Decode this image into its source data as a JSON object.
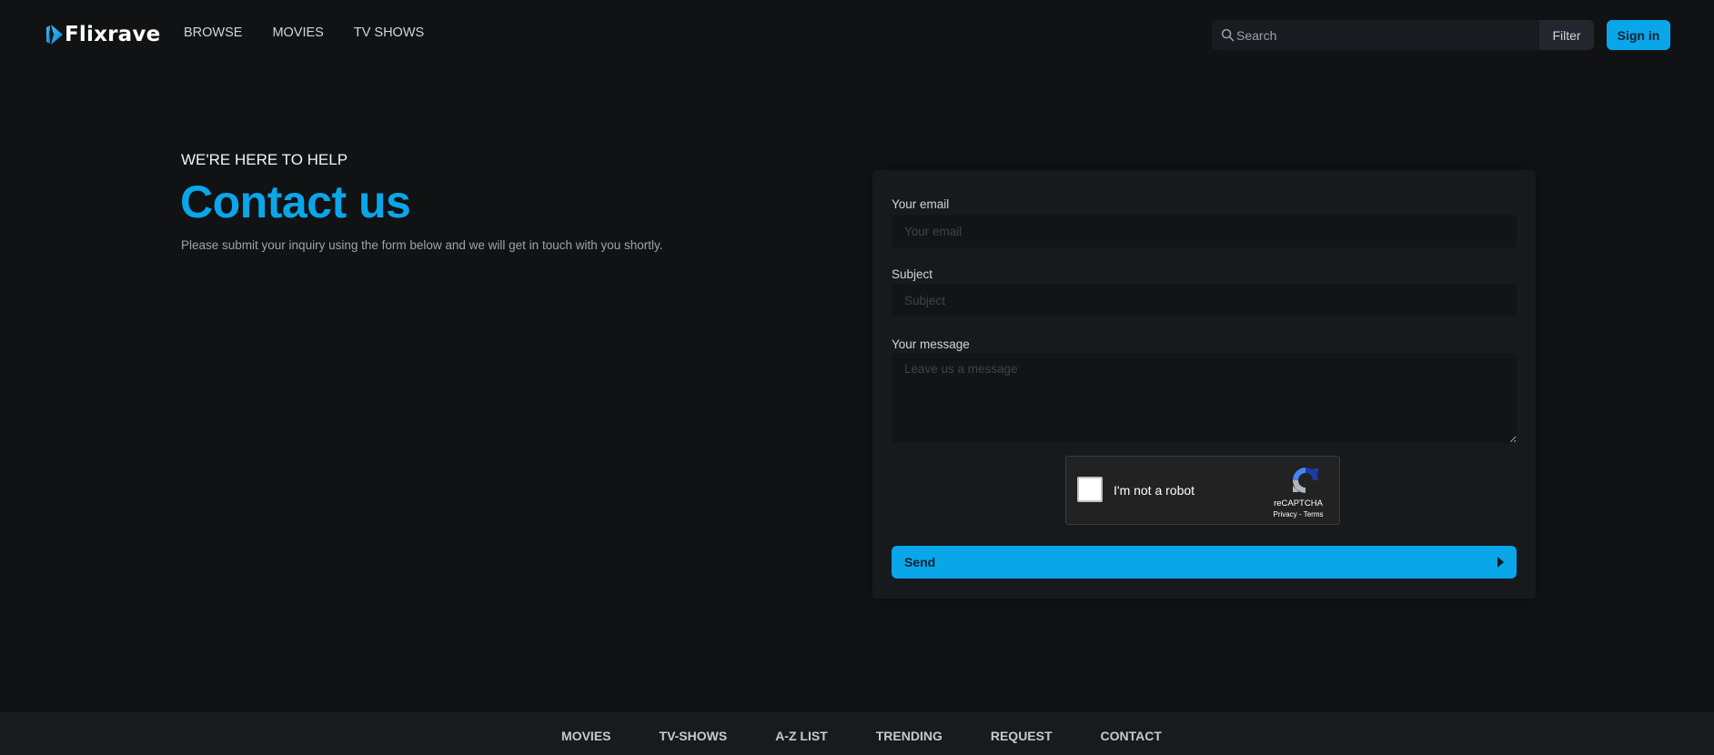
{
  "header": {
    "logo_text": "Flixrave",
    "nav": [
      "BROWSE",
      "MOVIES",
      "TV SHOWS"
    ],
    "search_placeholder": "Search",
    "filter_label": "Filter",
    "signin_label": "Sign in"
  },
  "intro": {
    "eyebrow": "WE'RE HERE TO HELP",
    "title": "Contact us",
    "subtitle": "Please submit your inquiry using the form below and we will get in touch with you shortly."
  },
  "form": {
    "email": {
      "label": "Your email",
      "placeholder": "Your email",
      "value": ""
    },
    "subject": {
      "label": "Subject",
      "placeholder": "Subject",
      "value": ""
    },
    "message": {
      "label": "Your message",
      "placeholder": "Leave us a message",
      "value": ""
    },
    "captcha": {
      "label": "I'm not a robot",
      "brand": "reCAPTCHA",
      "links": "Privacy - Terms",
      "checked": false
    },
    "send_label": "Send"
  },
  "footer": {
    "links": [
      "MOVIES",
      "TV-SHOWS",
      "A-Z LIST",
      "TRENDING",
      "REQUEST",
      "CONTACT"
    ]
  },
  "colors": {
    "accent": "#0aa6ea",
    "background": "#111214",
    "panel": "#171a1d",
    "footer": "#181b1e"
  }
}
